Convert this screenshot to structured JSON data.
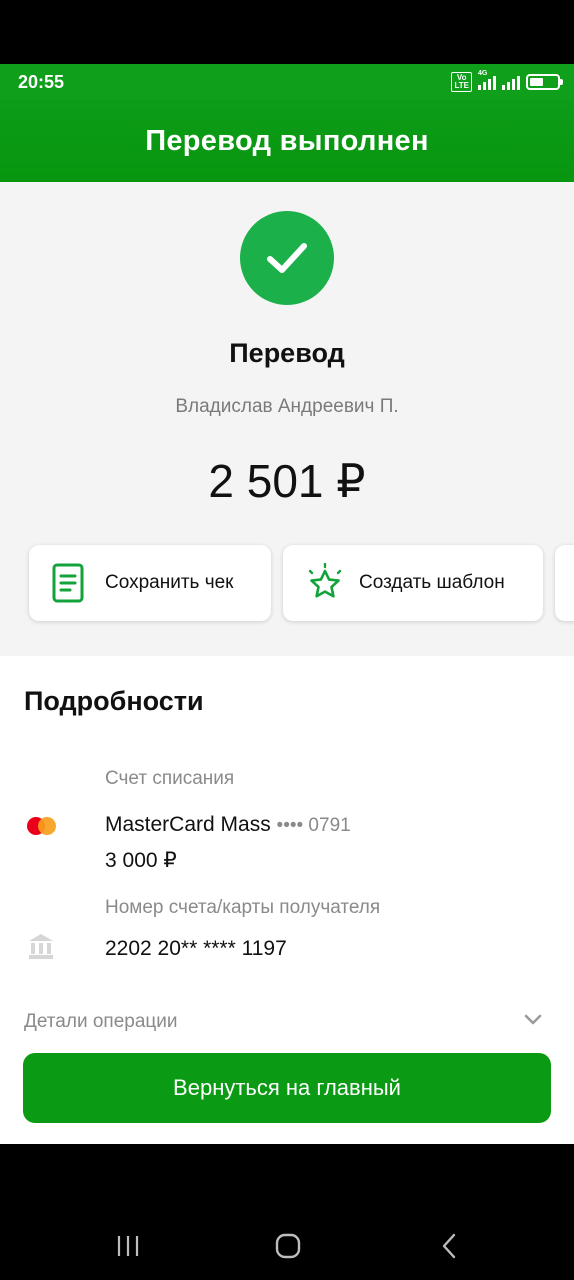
{
  "status": {
    "time": "20:55",
    "volte": "Vo LTE",
    "network": "4G",
    "battery_level": 0.5
  },
  "appbar": {
    "title": "Перевод выполнен"
  },
  "hero": {
    "title": "Перевод",
    "recipient": "Владислав Андреевич П.",
    "amount": "2 501 ₽"
  },
  "actions": [
    {
      "label": "Сохранить чек",
      "icon": "receipt-icon"
    },
    {
      "label": "Создать шаблон",
      "icon": "star-icon"
    }
  ],
  "details": {
    "title": "Подробности",
    "debit_label": "Счет списания",
    "card_name": "MasterCard Mass",
    "card_mask": "•••• 0791",
    "card_balance": "3 000 ₽",
    "recipient_label": "Номер счета/карты получателя",
    "recipient_number": "2202 20** **** 1197",
    "operation_details": "Детали операции"
  },
  "bottom": {
    "button_label": "Вернуться на главный"
  },
  "colors": {
    "brand_green": "#0a9a14",
    "success_circle": "#1bb04a",
    "status_bar": "#0f9f1a"
  }
}
